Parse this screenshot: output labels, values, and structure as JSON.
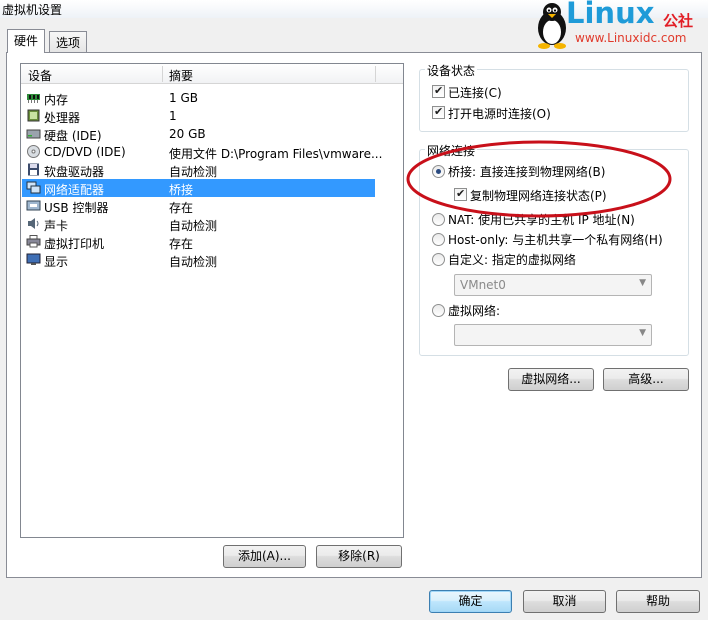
{
  "window": {
    "title": "虚拟机设置"
  },
  "watermark": {
    "brand": "Linux",
    "brand_suffix": "公社",
    "url": "www.Linuxidc.com"
  },
  "tabs": [
    {
      "label": "硬件",
      "active": true
    },
    {
      "label": "选项",
      "active": false
    }
  ],
  "device_list": {
    "columns": {
      "device": "设备",
      "summary": "摘要"
    },
    "rows": [
      {
        "device": "内存",
        "summary": "1 GB",
        "icon": "memory-icon"
      },
      {
        "device": "处理器",
        "summary": "1",
        "icon": "processor-icon"
      },
      {
        "device": "硬盘 (IDE)",
        "summary": "20 GB",
        "icon": "hard-disk-icon"
      },
      {
        "device": "CD/DVD (IDE)",
        "summary": "使用文件 D:\\Program Files\\vmware...",
        "icon": "cd-dvd-icon"
      },
      {
        "device": "软盘驱动器",
        "summary": "自动检测",
        "icon": "floppy-icon"
      },
      {
        "device": "网络适配器",
        "summary": "桥接",
        "icon": "network-adapter-icon",
        "selected": true
      },
      {
        "device": "USB 控制器",
        "summary": "存在",
        "icon": "usb-icon"
      },
      {
        "device": "声卡",
        "summary": "自动检测",
        "icon": "sound-card-icon"
      },
      {
        "device": "虚拟打印机",
        "summary": "存在",
        "icon": "printer-icon"
      },
      {
        "device": "显示",
        "summary": "自动检测",
        "icon": "display-icon"
      }
    ]
  },
  "list_buttons": {
    "add": "添加(A)...",
    "remove": "移除(R)"
  },
  "device_status": {
    "title": "设备状态",
    "connected": {
      "label": "已连接(C)",
      "checked": true
    },
    "connect_at_power_on": {
      "label": "打开电源时连接(O)",
      "checked": true
    }
  },
  "network_connection": {
    "title": "网络连接",
    "bridged": {
      "label": "桥接: 直接连接到物理网络(B)",
      "selected": true
    },
    "replicate_state": {
      "label": "复制物理网络连接状态(P)",
      "checked": true
    },
    "nat": {
      "label": "NAT: 使用已共享的主机 IP 地址(N)",
      "selected": false
    },
    "host_only": {
      "label": "Host-only: 与主机共享一个私有网络(H)",
      "selected": false
    },
    "custom": {
      "label": "自定义: 指定的虚拟网络",
      "selected": false
    },
    "custom_value": "VMnet0",
    "virtual_network": {
      "label": "虚拟网络:",
      "selected": false
    },
    "virtual_network_value": ""
  },
  "panel_buttons": {
    "virtual_networks": "虚拟网络...",
    "advanced": "高级..."
  },
  "dialog_buttons": {
    "ok": "确定",
    "cancel": "取消",
    "help": "帮助"
  },
  "colors": {
    "selection": "#3399ff",
    "highlight_ellipse": "#c8101a",
    "brand_blue": "#1f9bd8",
    "brand_red": "#e21e26"
  }
}
